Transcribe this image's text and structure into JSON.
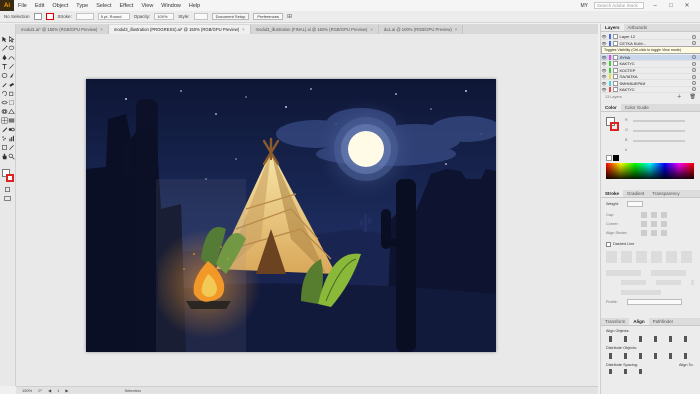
{
  "menubar": {
    "app_logo": "Ai",
    "items": [
      "File",
      "Edit",
      "Object",
      "Type",
      "Select",
      "Effect",
      "View",
      "Window",
      "Help"
    ],
    "workspace": "MY",
    "search_placeholder": "Search Adobe Stock"
  },
  "control": {
    "selection_label": "No Selection",
    "stroke_label": "Stroke:",
    "brush_value": "5 pt. Round",
    "opacity_label": "Opacity:",
    "opacity_value": "100%",
    "style_label": "Style:",
    "doc_setup": "Document Setup",
    "preferences": "Preferences"
  },
  "tabs": [
    {
      "label": "modul1.ai* @ 150% (RGB/GPU Preview)",
      "active": false
    },
    {
      "label": "modul3_illustration (PROGRESS).ai* @ 150% (RGB/GPU Preview)",
      "active": true
    },
    {
      "label": "modul3_illustration (FINAL).ai @ 150% (RGB/GPU Preview)",
      "active": false
    },
    {
      "label": "du1.ai @ 100% (RGB/GPU Preview)",
      "active": false
    }
  ],
  "statusbar": {
    "zoom": "150%",
    "angle": "0°",
    "artboard": "1",
    "mode": "Selection"
  },
  "layers_panel": {
    "tabs": [
      "Layers",
      "Artboards"
    ],
    "rows": [
      {
        "name": "Layer 12",
        "color": "#4a6fe0",
        "selected": false
      },
      {
        "name": "CETKA KUM...",
        "color": "#4a6fe0",
        "selected": false
      },
      {
        "name": "ЛУНА",
        "color": "#e04ae0",
        "selected": true
      },
      {
        "name": "КАКТУС",
        "color": "#3ec93e",
        "selected": false
      },
      {
        "name": "КОСТЕР",
        "color": "#3ec93e",
        "selected": false
      },
      {
        "name": "ПАЛАТКА",
        "color": "#e0e04a",
        "selected": false
      },
      {
        "name": "ФИНИШЕРКИ",
        "color": "#4ad0e0",
        "selected": false
      },
      {
        "name": "КАКТУС",
        "color": "#e04a4a",
        "selected": false
      }
    ],
    "tooltip": "Toggles Visibility (Ctrl-click to toggle View mode)",
    "count": "13 Layers"
  },
  "color_panel": {
    "tabs": [
      "Color",
      "Color Guide"
    ],
    "channels": [
      "R",
      "G",
      "B"
    ],
    "hex": "#"
  },
  "stroke_panel": {
    "tabs": [
      "Stroke",
      "Gradient",
      "Transparency"
    ],
    "weight_label": "Weight:",
    "dashed_label": "Dashed Line",
    "cap_label": "Cap:",
    "corner_label": "Corner:",
    "align_label": "Align Stroke:",
    "profile_label": "Profile:"
  },
  "align_panel": {
    "tabs": [
      "Transform",
      "Align",
      "Pathfinder"
    ],
    "align_objects": "Align Objects:",
    "distribute_objects": "Distribute Objects:",
    "distribute_spacing": "Distribute Spacing:",
    "align_to": "Align To:"
  },
  "colors": {
    "accent": "#ff9a00",
    "night_sky": "#0f1a3a",
    "moon": "#fffbe6",
    "fire": "#ffb020"
  }
}
